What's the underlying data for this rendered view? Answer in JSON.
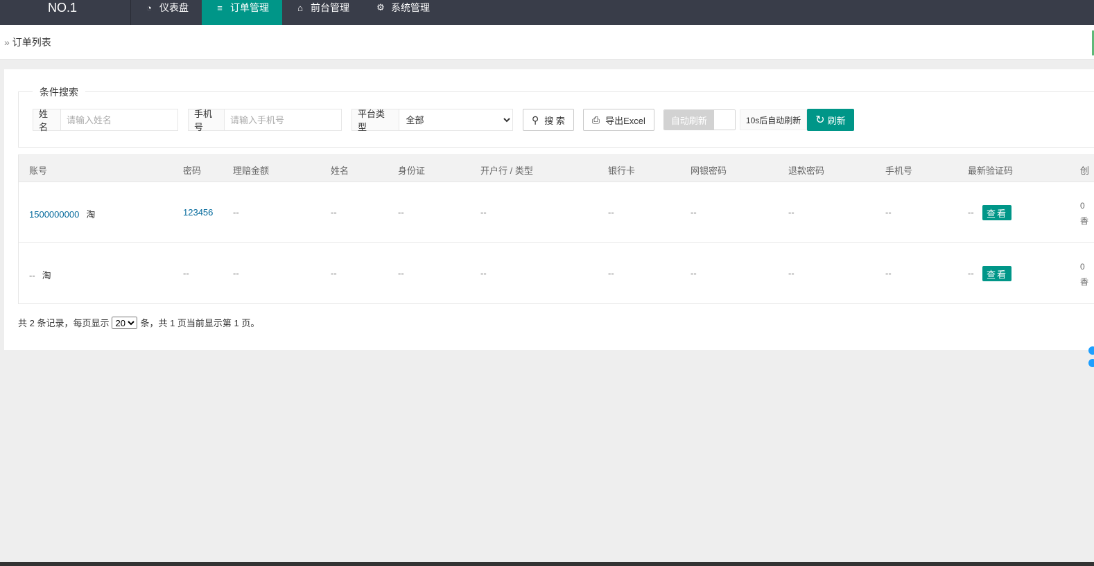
{
  "header": {
    "logo": "NO.1",
    "nav": [
      {
        "icon": "dashboard-icon",
        "glyph": "◔",
        "label": "仪表盘",
        "active": false
      },
      {
        "icon": "list-icon",
        "glyph": "≡",
        "label": "订单管理",
        "active": true
      },
      {
        "icon": "home-icon",
        "glyph": "⌂",
        "label": "前台管理",
        "active": false
      },
      {
        "icon": "gear-icon",
        "glyph": "⚙",
        "label": "系统管理",
        "active": false
      }
    ]
  },
  "breadcrumb": {
    "chevron": "»",
    "title": "订单列表"
  },
  "search": {
    "legend": "条件搜索",
    "name_label": "姓名",
    "name_placeholder": "请输入姓名",
    "phone_label": "手机号",
    "phone_placeholder": "请输入手机号",
    "platform_label": "平台类型",
    "platform_selected": "全部",
    "search_label": "搜 索",
    "export_label": "导出Excel",
    "auto_refresh_label": "自动刷新",
    "countdown": "10s后自动刷新",
    "refresh_label": "刷新"
  },
  "table": {
    "headers": [
      "账号",
      "密码",
      "理赔金额",
      "姓名",
      "身份证",
      "开户行 / 类型",
      "银行卡",
      "网银密码",
      "退款密码",
      "手机号",
      "最新验证码",
      "创"
    ],
    "rows": [
      {
        "account": "1500000000",
        "platform": "淘",
        "password": "123456",
        "claim": "--",
        "name": "--",
        "id_card": "--",
        "bank": "--",
        "card": "--",
        "netbank_pwd": "--",
        "refund_pwd": "--",
        "phone": "--",
        "code": "--",
        "view_label": "查看",
        "created_top": "0",
        "created_bottom": "香"
      },
      {
        "account": "--",
        "platform": "淘",
        "password": "--",
        "claim": "--",
        "name": "--",
        "id_card": "--",
        "bank": "--",
        "card": "--",
        "netbank_pwd": "--",
        "refund_pwd": "--",
        "phone": "--",
        "code": "--",
        "view_label": "查看",
        "created_top": "0",
        "created_bottom": "香"
      }
    ]
  },
  "pager": {
    "prefix": "共 2 条记录，每页显示",
    "page_size": "20",
    "suffix": "条，共 1 页当前显示第 1 页。"
  },
  "colors": {
    "topbar": "#393d49",
    "accent": "#009688",
    "link": "#01689b"
  }
}
